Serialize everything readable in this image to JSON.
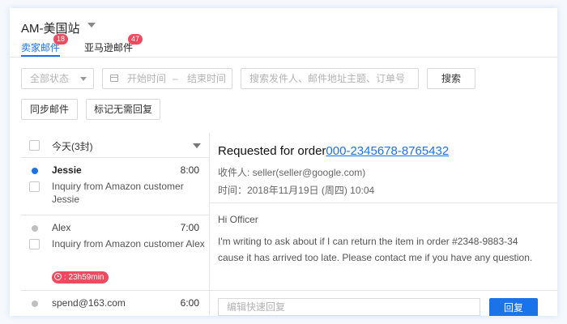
{
  "store": {
    "title": "AM-美国站"
  },
  "tabs": [
    {
      "label": "卖家邮件",
      "badge": "18",
      "active": true
    },
    {
      "label": "亚马逊邮件",
      "badge": "47",
      "active": false
    }
  ],
  "filters": {
    "status_value": "全部状态",
    "date_start_placeholder": "开始时间",
    "date_separator": "–",
    "date_end_placeholder": "结束时间",
    "search_placeholder": "搜索发件人、邮件地址主题、订单号",
    "search_button": "搜索"
  },
  "actions": {
    "sync": "同步邮件",
    "mark_no_reply": "标记无需回复"
  },
  "list": {
    "header": "今天(3封)",
    "items": [
      {
        "sender": "Jessie",
        "time": "8:00",
        "preview": "Inquiry from Amazon customer Jessie",
        "unread": true
      },
      {
        "sender": "Alex",
        "time": "7:00",
        "preview": "Inquiry from Amazon customer Alex",
        "timer": ": 23h59min",
        "unread": false
      },
      {
        "sender": "spend@163.com",
        "time": "6:00",
        "unread": false
      }
    ]
  },
  "detail": {
    "subject_prefix": "Requested for order",
    "order_number": "000-2345678-8765432",
    "recipient": "收件人: seller(seller@google.com)",
    "time": "时间：2018年11月19日 (周四) 10:04",
    "greeting": "Hi Officer",
    "body": "I'm writing to ask about if I can return the item in order #2348-9883-34 cause it has arrived too late. Please contact me if you have any question.",
    "reply_placeholder": "编辑快速回复",
    "reply_button": "回复"
  },
  "colors": {
    "accent": "#1a73e8",
    "badge": "#ef4a5f"
  }
}
